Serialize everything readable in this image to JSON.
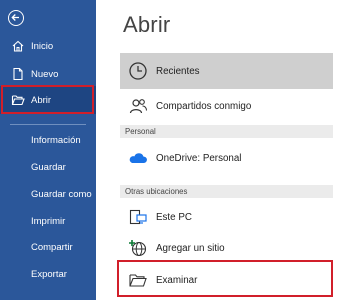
{
  "sidebar": {
    "top_items": [
      {
        "label": "Inicio",
        "icon": "home-icon"
      },
      {
        "label": "Nuevo",
        "icon": "new-document-icon"
      },
      {
        "label": "Abrir",
        "icon": "open-folder-icon"
      }
    ],
    "sub_items": [
      "Información",
      "Guardar",
      "Guardar como",
      "Imprimir",
      "Compartir",
      "Exportar"
    ],
    "back_icon": "back-arrow-icon",
    "bg_color": "#2b579a"
  },
  "main": {
    "title": "Abrir",
    "recent": {
      "label": "Recientes",
      "icon": "clock-icon"
    },
    "shared": {
      "label": "Compartidos conmigo",
      "icon": "people-icon"
    },
    "personal_header": "Personal",
    "onedrive": {
      "label": "OneDrive: Personal",
      "icon": "cloud-icon"
    },
    "other_header": "Otras ubicaciones",
    "this_pc": {
      "label": "Este PC",
      "icon": "computer-icon"
    },
    "add_site": {
      "label": "Agregar un sitio",
      "icon": "globe-add-icon"
    },
    "browse": {
      "label": "Examinar",
      "icon": "folder-icon"
    }
  },
  "highlight_color": "#d11f2a"
}
